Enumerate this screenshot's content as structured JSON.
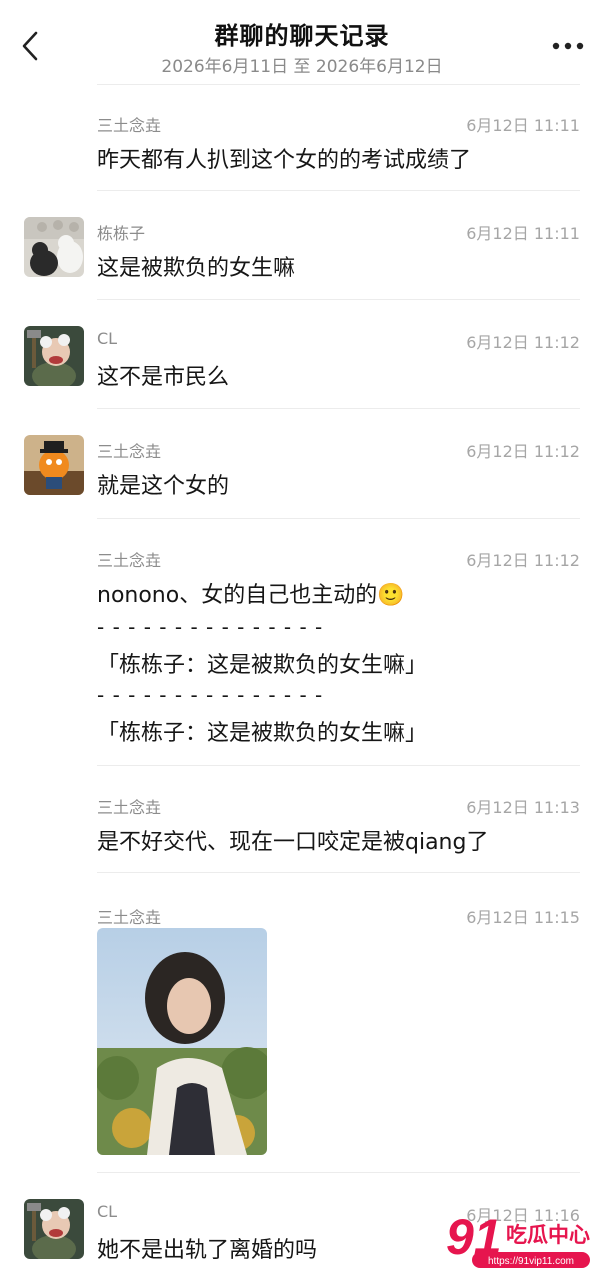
{
  "header": {
    "title": "群聊的聊天记录",
    "subtitle": "2026年6月11日 至 2026年6月12日",
    "back_icon": "chevron-left-icon",
    "more_icon": "more-dots-icon"
  },
  "messages": [
    {
      "sender": "三土念垚",
      "time": "6月12日 11:11",
      "text": "昨天都有人扒到这个女的的考试成绩了"
    },
    {
      "sender": "栋栋子",
      "time": "6月12日 11:11",
      "text": "这是被欺负的女生嘛"
    },
    {
      "sender": "CL",
      "time": "6月12日 11:12",
      "text": "这不是市民么"
    },
    {
      "sender": "三土念垚",
      "time": "6月12日 11:12",
      "text": "就是这个女的"
    },
    {
      "sender": "三土念垚",
      "time": "6月12日 11:12",
      "text": "nonono、女的自己也主动的",
      "emoji": "🙂",
      "separator": "- - - - - - - - - - - - - - -",
      "quotes": [
        "「栋栋子：这是被欺负的女生嘛」",
        "「栋栋子：这是被欺负的女生嘛」"
      ]
    },
    {
      "sender": "三土念垚",
      "time": "6月12日 11:13",
      "text": "是不好交代、现在一口咬定是被qiang了"
    },
    {
      "sender": "三土念垚",
      "time": "6月12日 11:15",
      "image": "photo-of-woman"
    },
    {
      "sender": "CL",
      "time": "6月12日 11:16",
      "text": "她不是出轨了离婚的吗"
    }
  ],
  "watermark": {
    "brand_number": "91",
    "brand_name": "吃瓜中心",
    "url": "https://91vip11.com"
  },
  "colors": {
    "accent": "#e6154e",
    "sender": "#8c8c8c",
    "time": "#a6a6a6"
  }
}
